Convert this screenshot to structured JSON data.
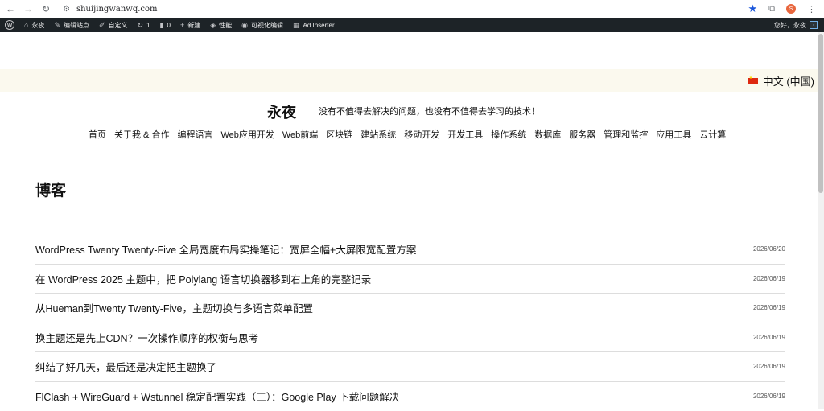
{
  "browser": {
    "url": "shuijingwanwq.com",
    "profile_initial": "S"
  },
  "adminbar": {
    "items": [
      {
        "icon": "home-icon",
        "label": "永夜"
      },
      {
        "icon": "brush-icon",
        "label": "编辑站点"
      },
      {
        "icon": "pencil-icon",
        "label": "自定义"
      },
      {
        "icon": "update-icon",
        "label": "1"
      },
      {
        "icon": "comment-icon",
        "label": "0"
      },
      {
        "icon": "plus-icon",
        "label": "新建"
      },
      {
        "icon": "performance-icon",
        "label": "性能"
      },
      {
        "icon": "eye-icon",
        "label": "可视化编辑"
      },
      {
        "icon": "grid-icon",
        "label": "Ad Inserter"
      }
    ],
    "greeting": "您好，永夜"
  },
  "language": {
    "label": "中文 (中国)",
    "flag_icon": "china-flag-icon"
  },
  "site": {
    "title": "永夜",
    "tagline": "没有不值得去解决的问题，也没有不值得去学习的技术！"
  },
  "nav": [
    "首页",
    "关于我 & 合作",
    "编程语言",
    "Web应用开发",
    "Web前端",
    "区块链",
    "建站系统",
    "移动开发",
    "开发工具",
    "操作系统",
    "数据库",
    "服务器",
    "管理和监控",
    "应用工具",
    "云计算"
  ],
  "page": {
    "title": "博客"
  },
  "posts": [
    {
      "title": "WordPress Twenty Twenty-Five 全局宽度布局实操笔记：宽屏全幅+大屏限宽配置方案",
      "date": "2026/06/20"
    },
    {
      "title": "在 WordPress 2025 主题中，把 Polylang 语言切换器移到右上角的完整记录",
      "date": "2026/06/19"
    },
    {
      "title": "从Hueman到Twenty Twenty-Five，主题切换与多语言菜单配置",
      "date": "2026/06/19"
    },
    {
      "title": "换主题还是先上CDN？一次操作顺序的权衡与思考",
      "date": "2026/06/19"
    },
    {
      "title": "纠结了好几天，最后还是决定把主题换了",
      "date": "2026/06/19"
    },
    {
      "title": "FlClash + WireGuard + Wstunnel 稳定配置实践（三）：Google Play 下载问题解决",
      "date": "2026/06/19"
    }
  ]
}
